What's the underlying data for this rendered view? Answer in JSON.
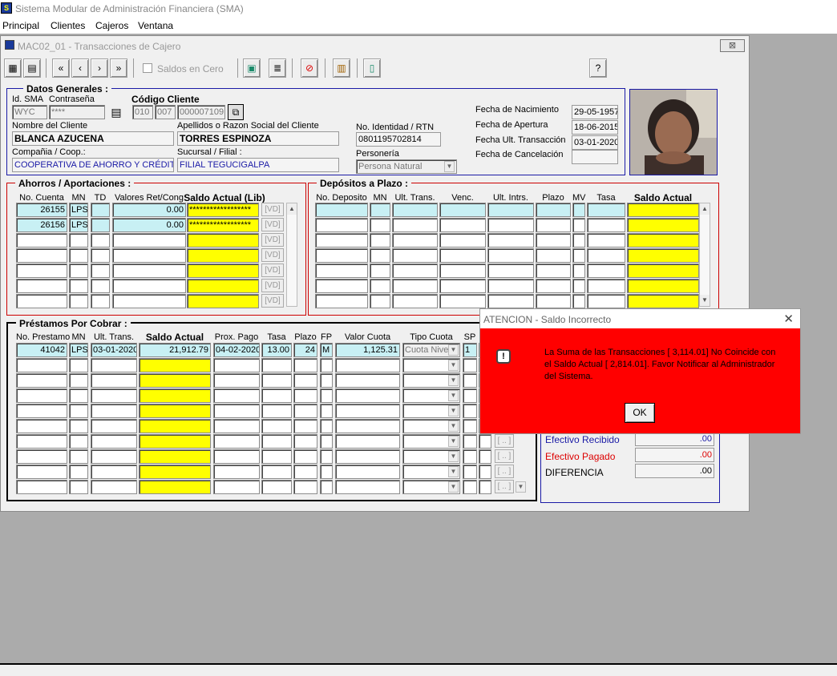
{
  "app": {
    "title": "Sistema Modular de Administración Financiera (SMA)"
  },
  "menu": [
    "Principal",
    "Clientes",
    "Cajeros",
    "Ventana"
  ],
  "window": {
    "title": "MAC02_01 - Transacciones de Cajero",
    "close_glyph": "⊠"
  },
  "toolbar": {
    "saldos_label": "Saldos en Cero",
    "help_label": "?"
  },
  "datos": {
    "title": "Datos Generales :",
    "id_sma_label": "Id. SMA",
    "password_label": "Contraseña",
    "codigo_label": "Código Cliente",
    "id_sma": "WYC",
    "password": "****",
    "code1": "010",
    "code2": "007",
    "code3": "000007109",
    "nombre_label": "Nombre del Cliente",
    "nombre": "BLANCA  AZUCENA",
    "apellidos_label": "Apellidos o Razon Social del Cliente",
    "apellidos": "TORRES ESPINOZA",
    "identidad_label": "No. Identidad / RTN",
    "identidad": "0801195702814",
    "compania_label": "Compañia / Coop.:",
    "compania": "COOPERATIVA DE AHORRO Y CRÉDITO",
    "sucursal_label": "Sucursal / Filial :",
    "sucursal": "FILIAL TEGUCIGALPA",
    "personeria_label": "Personería",
    "personeria": "Persona Natural",
    "fecha_nac_label": "Fecha de Nacimiento",
    "fecha_nac": "29-05-1957",
    "fecha_ap_label": "Fecha de  Apertura",
    "fecha_ap": "18-06-2015",
    "fecha_ult_label": "Fecha Ult. Transacción",
    "fecha_ult": "03-01-2020",
    "fecha_can_label": "Fecha de Cancelación",
    "fecha_can": ""
  },
  "ahorros": {
    "title": "Ahorros / Aportaciones :",
    "headers": [
      "No. Cuenta",
      "MN",
      "TD",
      "Valores Ret/Cong",
      "Saldo Actual (Lib)"
    ],
    "vd_label": "[VD]",
    "rows": [
      {
        "cuenta": "26155",
        "mn": "LPS",
        "td": "",
        "valores": "0.00",
        "saldo": "******************"
      },
      {
        "cuenta": "26156",
        "mn": "LPS",
        "td": "",
        "valores": "0.00",
        "saldo": "******************"
      }
    ]
  },
  "depositos": {
    "title": "Depósitos a Plazo :",
    "headers": [
      "No. Deposito",
      "MN",
      "Ult. Trans.",
      "Venc.",
      "Ult. Intrs.",
      "Plazo",
      "MV",
      "Tasa",
      "Saldo Actual"
    ]
  },
  "prestamos": {
    "title": "Préstamos Por Cobrar :",
    "headers": [
      "No. Prestamo",
      "MN",
      "Ult. Trans.",
      "Saldo Actual",
      "Prox. Pago",
      "Tasa",
      "Plazo",
      "FP",
      "Valor Cuota",
      "Tipo Cuota",
      "SP"
    ],
    "row": {
      "numero": "41042",
      "mn": "LPS",
      "ult": "03-01-2020",
      "saldo": "21,912.79",
      "prox": "04-02-2020",
      "tasa": "13.00",
      "plazo": "24",
      "fp": "M",
      "cuota": "1,125.31",
      "tipo": "Cuota Nive",
      "sp": "1"
    },
    "btn_label": "[ .. ]"
  },
  "efectivo": {
    "recibido_label": "Efectivo Recibido",
    "recibido": ".00",
    "pagado_label": "Efectivo Pagado",
    "pagado": ".00",
    "diferencia_label": "DIFERENCIA",
    "diferencia": ".00"
  },
  "dialog": {
    "title": "ATENCION - Saldo Incorrecto",
    "close": "✕",
    "message": "La Suma de las Transacciones [       3,114.01] No Coincide con el Saldo Actual [       2,814.01]. Favor Notificar al Administrador del Sistema.",
    "ok": "OK"
  },
  "colors": {
    "dialog_bg": "#ff0000",
    "saldo_bg": "#ffff00",
    "row_bg": "#c8f0f4",
    "frame_blue": "#1a1aa6",
    "frame_red": "#cc0000"
  },
  "icons": [
    "app-logo-icon",
    "window-icon",
    "toolbar-icons",
    "first-record-icon",
    "prev-record-icon",
    "next-record-icon",
    "last-record-icon",
    "calculator-icon",
    "lookup-icon",
    "warning-icon",
    "photo"
  ]
}
